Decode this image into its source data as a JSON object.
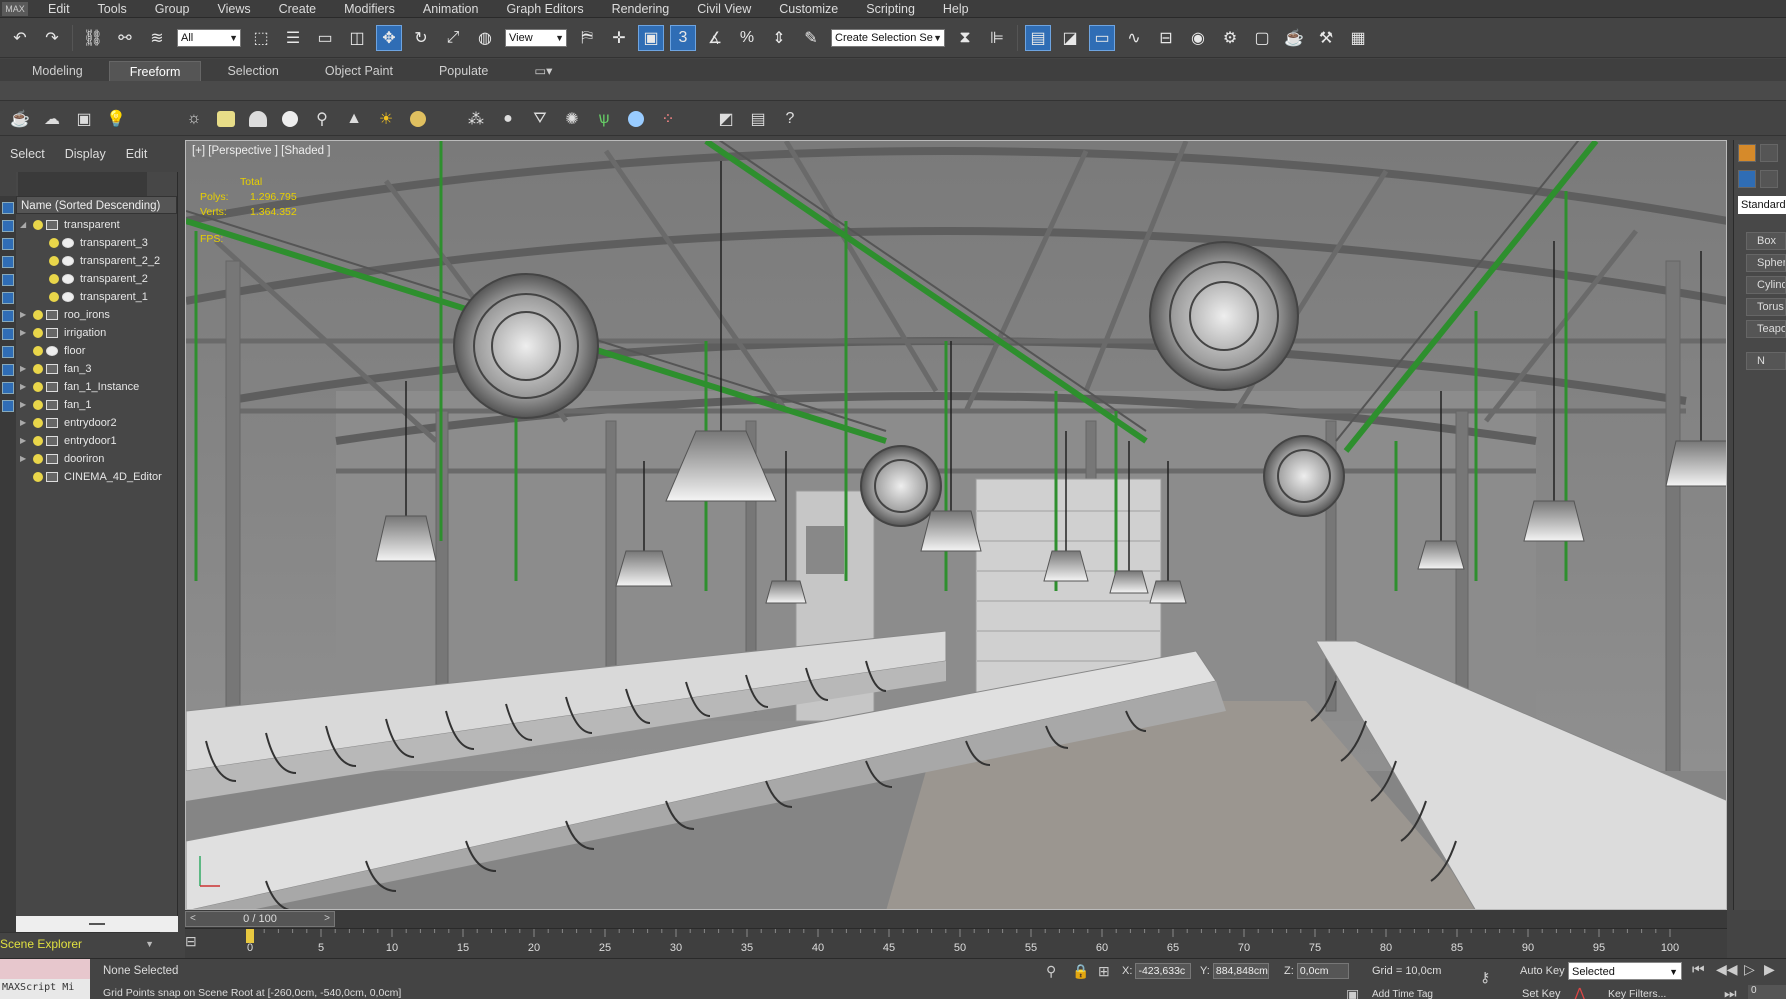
{
  "app": {
    "logo": "MAX"
  },
  "menu": [
    "Edit",
    "Tools",
    "Group",
    "Views",
    "Create",
    "Modifiers",
    "Animation",
    "Graph Editors",
    "Rendering",
    "Civil View",
    "Customize",
    "Scripting",
    "Help"
  ],
  "toolbar": {
    "filter_value": "All",
    "refcoord_value": "View",
    "snap_value": "3",
    "selection_set_placeholder": "Create Selection Se"
  },
  "ribbon": {
    "tabs": [
      "Modeling",
      "Freeform",
      "Selection",
      "Object Paint",
      "Populate"
    ],
    "active": "Freeform"
  },
  "scene_explorer": {
    "tabs": [
      "Select",
      "Display",
      "Edit"
    ],
    "column_header": "Name (Sorted Descending)",
    "title": "Scene Explorer",
    "items": [
      {
        "label": "transparent",
        "depth": 0,
        "expander": "open",
        "icon": "layer"
      },
      {
        "label": "transparent_3",
        "depth": 1,
        "expander": "none",
        "icon": "sphere"
      },
      {
        "label": "transparent_2_2",
        "depth": 1,
        "expander": "none",
        "icon": "sphere"
      },
      {
        "label": "transparent_2",
        "depth": 1,
        "expander": "none",
        "icon": "sphere"
      },
      {
        "label": "transparent_1",
        "depth": 1,
        "expander": "none",
        "icon": "sphere"
      },
      {
        "label": "roo_irons",
        "depth": 0,
        "expander": "closed",
        "icon": "layer"
      },
      {
        "label": "irrigation",
        "depth": 0,
        "expander": "closed",
        "icon": "layer"
      },
      {
        "label": "floor",
        "depth": 0,
        "expander": "none",
        "icon": "sphere"
      },
      {
        "label": "fan_3",
        "depth": 0,
        "expander": "closed",
        "icon": "layer"
      },
      {
        "label": "fan_1_Instance",
        "depth": 0,
        "expander": "closed",
        "icon": "layer"
      },
      {
        "label": "fan_1",
        "depth": 0,
        "expander": "closed",
        "icon": "layer"
      },
      {
        "label": "entrydoor2",
        "depth": 0,
        "expander": "closed",
        "icon": "layer"
      },
      {
        "label": "entrydoor1",
        "depth": 0,
        "expander": "closed",
        "icon": "layer"
      },
      {
        "label": "dooriron",
        "depth": 0,
        "expander": "closed",
        "icon": "layer"
      },
      {
        "label": "CINEMA_4D_Editor",
        "depth": 0,
        "expander": "none",
        "icon": "camera"
      }
    ]
  },
  "viewport": {
    "label": "[+] [Perspective ] [Shaded ]",
    "stats": {
      "header": "Total",
      "polys_label": "Polys:",
      "polys": "1.296.795",
      "verts_label": "Verts:",
      "verts": "1.364.352",
      "fps_label": "FPS:"
    }
  },
  "command_panel": {
    "dropdown": "Standard",
    "primitives": [
      "Box",
      "Sphere",
      "Cylinder",
      "Torus",
      "Teapot"
    ],
    "rollout2": "N"
  },
  "time_slider": {
    "position": "0 / 100",
    "prev": "<",
    "next": ">"
  },
  "track_ticks": [
    "0",
    "5",
    "10",
    "15",
    "20",
    "25",
    "30",
    "35",
    "40",
    "45",
    "50",
    "55",
    "60",
    "65",
    "70",
    "75",
    "80",
    "85",
    "90",
    "95",
    "100"
  ],
  "status": {
    "maxscript": "MAXScript Mi",
    "selection": "None Selected",
    "prompt": "Grid Points snap on Scene Root at [-260,0cm, -540,0cm, 0,0cm]",
    "x_label": "X:",
    "x_value": "-423,633c",
    "y_label": "Y:",
    "y_value": "884,848cm",
    "z_label": "Z:",
    "z_value": "0,0cm",
    "grid": "Grid = 10,0cm",
    "add_time_tag": "Add Time Tag",
    "auto_key": "Auto Key",
    "key_mode": "Selected",
    "set_key": "Set Key",
    "key_filters": "Key Filters...",
    "frame": "0"
  },
  "colors": {
    "pipe_green": "#2e8f2e",
    "highlight_blue": "#2f6db5",
    "stats_yellow": "#e8d000"
  }
}
